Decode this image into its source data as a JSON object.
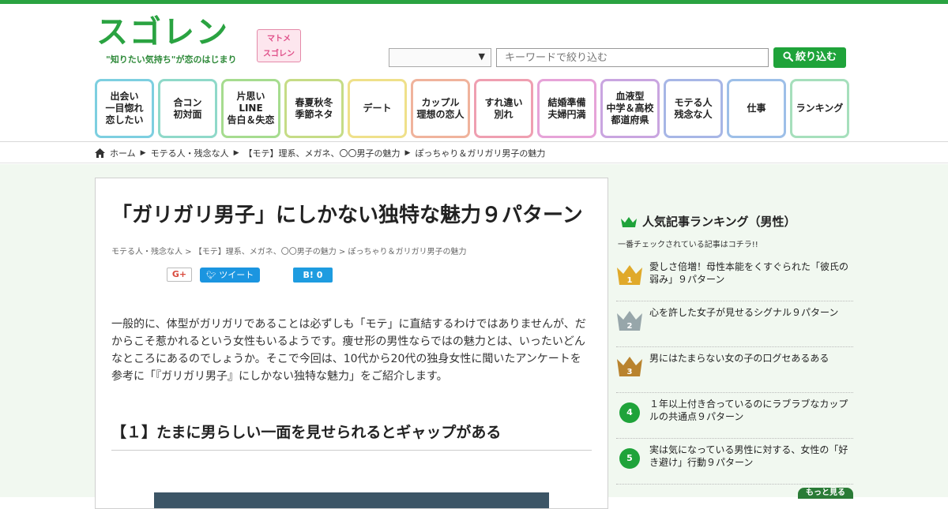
{
  "header": {
    "logo_text": "スゴレン",
    "logo_tagline": "\"知りたい気持ち\"が恋のはじまり",
    "matome_label": "マトメ\nスゴレン",
    "search": {
      "placeholder": "キーワードで絞り込む",
      "button_label": "絞り込む"
    }
  },
  "nav": {
    "items": [
      {
        "label": "出会い\n一目惚れ\n恋したい",
        "color": "#7dcfe0"
      },
      {
        "label": "合コン\n初対面",
        "color": "#8fd9c9"
      },
      {
        "label": "片思い\nLINE\n告白＆失恋",
        "color": "#a6dc8f"
      },
      {
        "label": "春夏秋冬\n季節ネタ",
        "color": "#c6dc86"
      },
      {
        "label": "デート",
        "color": "#efe08a"
      },
      {
        "label": "カップル\n理想の恋人",
        "color": "#f0b39c"
      },
      {
        "label": "すれ違い\n別れ",
        "color": "#ef9fb1"
      },
      {
        "label": "結婚準備\n夫婦円満",
        "color": "#e6a3d8"
      },
      {
        "label": "血液型\n中学＆高校\n都道府県",
        "color": "#c9a5e0"
      },
      {
        "label": "モテる人\n残念な人",
        "color": "#a7b6e6"
      },
      {
        "label": "仕事",
        "color": "#9dbfe8"
      },
      {
        "label": "ランキング",
        "color": "#a6dfbc"
      }
    ]
  },
  "breadcrumb": {
    "home": "ホーム",
    "items": [
      "モテる人・残念な人",
      "【モテ】理系、メガネ、〇〇男子の魅力",
      "ぽっちゃり＆ガリガリ男子の魅力"
    ]
  },
  "article": {
    "title": "「ガリガリ男子」にしかない独特な魅力９パターン",
    "crumb": "モテる人・残念な人 > 【モテ】理系、メガネ、〇〇男子の魅力 > ぽっちゃり＆ガリガリ男子の魅力",
    "share": {
      "gplus": "G+",
      "tweet": "ツイート",
      "hatena": "B! 0"
    },
    "body": "一般的に、体型がガリガリであることは必ずしも「モテ」に直結するわけではありませんが、だからこそ惹かれるという女性もいるようです。痩せ形の男性ならではの魅力とは、いったいどんなところにあるのでしょうか。そこで今回は、10代から20代の独身女性に聞いたアンケートを参考に「『ガリガリ男子』にしかない独特な魅力」をご紹介します。",
    "section_title": "【１】たまに男らしい一面を見せられるとギャップがある"
  },
  "sidebar": {
    "heading": "人気記事ランキング（男性）",
    "subheading": "一番チェックされている記事はコチラ!!",
    "items": [
      {
        "rank": "1",
        "title": "愛しさ倍増！母性本能をくすぐられた「彼氏の弱み」９パターン",
        "color": "#e0a92a"
      },
      {
        "rank": "2",
        "title": "心を許した女子が見せるシグナル９パターン",
        "color": "#97a6aa"
      },
      {
        "rank": "3",
        "title": "男にはたまらない女の子の口グセあるある",
        "color": "#b9832e"
      },
      {
        "rank": "4",
        "title": "１年以上付き合っているのにラブラブなカップルの共通点９パターン",
        "color": "#1fa33a"
      },
      {
        "rank": "5",
        "title": "実は気になっている男性に対する、女性の「好き避け」行動９パターン",
        "color": "#1fa33a"
      }
    ],
    "more_label": "もっと見る"
  }
}
